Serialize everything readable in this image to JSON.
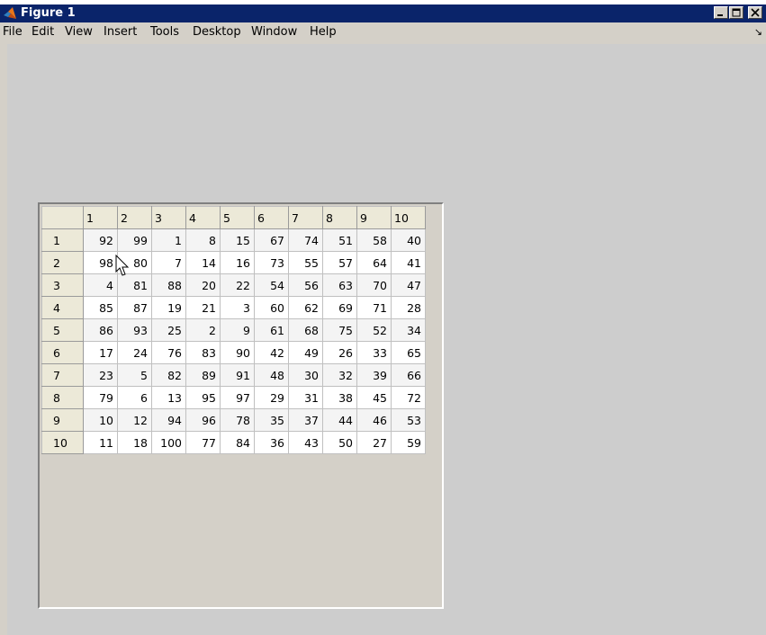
{
  "window": {
    "title": "Figure 1",
    "icon": "matlab-icon",
    "controls": {
      "minimize": "minimize-icon",
      "maximize": "maximize-icon",
      "close": "close-icon"
    }
  },
  "menu": {
    "items": [
      "File",
      "Edit",
      "View",
      "Insert",
      "Tools",
      "Desktop",
      "Window",
      "Help"
    ],
    "dock_arrow": "↘"
  },
  "table": {
    "column_headers": [
      "1",
      "2",
      "3",
      "4",
      "5",
      "6",
      "7",
      "8",
      "9",
      "10"
    ],
    "row_headers": [
      "1",
      "2",
      "3",
      "4",
      "5",
      "6",
      "7",
      "8",
      "9",
      "10"
    ],
    "rows": [
      [
        "92",
        "99",
        "1",
        "8",
        "15",
        "67",
        "74",
        "51",
        "58",
        "40"
      ],
      [
        "98",
        "80",
        "7",
        "14",
        "16",
        "73",
        "55",
        "57",
        "64",
        "41"
      ],
      [
        "4",
        "81",
        "88",
        "20",
        "22",
        "54",
        "56",
        "63",
        "70",
        "47"
      ],
      [
        "85",
        "87",
        "19",
        "21",
        "3",
        "60",
        "62",
        "69",
        "71",
        "28"
      ],
      [
        "86",
        "93",
        "25",
        "2",
        "9",
        "61",
        "68",
        "75",
        "52",
        "34"
      ],
      [
        "17",
        "24",
        "76",
        "83",
        "90",
        "42",
        "49",
        "26",
        "33",
        "65"
      ],
      [
        "23",
        "5",
        "82",
        "89",
        "91",
        "48",
        "30",
        "32",
        "39",
        "66"
      ],
      [
        "79",
        "6",
        "13",
        "95",
        "97",
        "29",
        "31",
        "38",
        "45",
        "72"
      ],
      [
        "10",
        "12",
        "94",
        "96",
        "78",
        "35",
        "37",
        "44",
        "46",
        "53"
      ],
      [
        "11",
        "18",
        "100",
        "77",
        "84",
        "36",
        "43",
        "50",
        "27",
        "59"
      ]
    ]
  },
  "colors": {
    "titlebar": "#0a246a",
    "chrome": "#d4d0c8",
    "figure_background": "#cdcdcd"
  }
}
